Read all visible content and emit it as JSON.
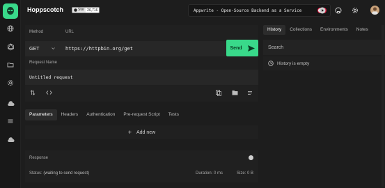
{
  "app": {
    "title": "Hoppscotch"
  },
  "header": {
    "star_badge": {
      "label": "Star",
      "count": "26,716"
    },
    "promo": {
      "text": "Appwrite - Open-Source Backend as a Service"
    }
  },
  "rail": {
    "items": [
      {
        "icon": "globe-icon"
      },
      {
        "icon": "graphql-icon"
      },
      {
        "icon": "folder-icon"
      },
      {
        "icon": "gear-icon"
      },
      {
        "icon": "cloud-upload-icon"
      },
      {
        "icon": "sliders-icon"
      },
      {
        "icon": "cloud-download-icon"
      }
    ]
  },
  "request": {
    "method_label": "Method",
    "url_label": "URL",
    "method_value": "GET",
    "url_value": "https://httpbin.org/get",
    "send_label": "Send",
    "name_label": "Request Name",
    "name_value": "Untitled request"
  },
  "tabs": [
    {
      "label": "Parameters",
      "active": true
    },
    {
      "label": "Headers"
    },
    {
      "label": "Authentication"
    },
    {
      "label": "Pre-request Script"
    },
    {
      "label": "Tests"
    }
  ],
  "params": {
    "add_new_label": "Add new"
  },
  "response": {
    "title": "Response",
    "status_label": "Status:",
    "status_value": "(waiting to send request)",
    "duration_label": "Duration:",
    "duration_value": "0 ms",
    "size_label": "Size:",
    "size_value": "0 B"
  },
  "right_panel": {
    "tabs": [
      {
        "label": "History",
        "active": true
      },
      {
        "label": "Collections"
      },
      {
        "label": "Environments"
      },
      {
        "label": "Notes"
      }
    ],
    "search_placeholder": "Search",
    "empty_text": "History is empty"
  },
  "colors": {
    "accent": "#39d98a",
    "toggle": "#e0143c",
    "background": "#1d1d1d"
  }
}
